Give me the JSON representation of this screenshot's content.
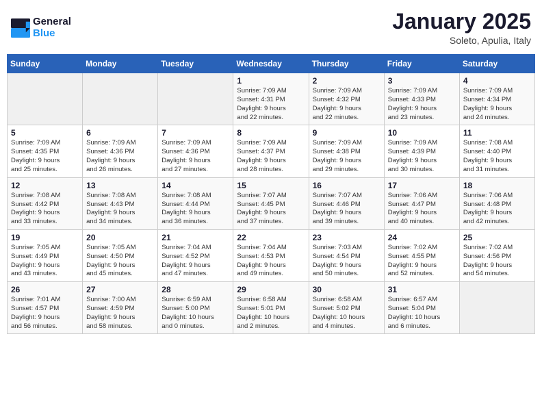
{
  "header": {
    "logo_line1": "General",
    "logo_line2": "Blue",
    "month": "January 2025",
    "location": "Soleto, Apulia, Italy"
  },
  "weekdays": [
    "Sunday",
    "Monday",
    "Tuesday",
    "Wednesday",
    "Thursday",
    "Friday",
    "Saturday"
  ],
  "weeks": [
    [
      {
        "day": "",
        "info": ""
      },
      {
        "day": "",
        "info": ""
      },
      {
        "day": "",
        "info": ""
      },
      {
        "day": "1",
        "info": "Sunrise: 7:09 AM\nSunset: 4:31 PM\nDaylight: 9 hours\nand 22 minutes."
      },
      {
        "day": "2",
        "info": "Sunrise: 7:09 AM\nSunset: 4:32 PM\nDaylight: 9 hours\nand 22 minutes."
      },
      {
        "day": "3",
        "info": "Sunrise: 7:09 AM\nSunset: 4:33 PM\nDaylight: 9 hours\nand 23 minutes."
      },
      {
        "day": "4",
        "info": "Sunrise: 7:09 AM\nSunset: 4:34 PM\nDaylight: 9 hours\nand 24 minutes."
      }
    ],
    [
      {
        "day": "5",
        "info": "Sunrise: 7:09 AM\nSunset: 4:35 PM\nDaylight: 9 hours\nand 25 minutes."
      },
      {
        "day": "6",
        "info": "Sunrise: 7:09 AM\nSunset: 4:36 PM\nDaylight: 9 hours\nand 26 minutes."
      },
      {
        "day": "7",
        "info": "Sunrise: 7:09 AM\nSunset: 4:36 PM\nDaylight: 9 hours\nand 27 minutes."
      },
      {
        "day": "8",
        "info": "Sunrise: 7:09 AM\nSunset: 4:37 PM\nDaylight: 9 hours\nand 28 minutes."
      },
      {
        "day": "9",
        "info": "Sunrise: 7:09 AM\nSunset: 4:38 PM\nDaylight: 9 hours\nand 29 minutes."
      },
      {
        "day": "10",
        "info": "Sunrise: 7:09 AM\nSunset: 4:39 PM\nDaylight: 9 hours\nand 30 minutes."
      },
      {
        "day": "11",
        "info": "Sunrise: 7:08 AM\nSunset: 4:40 PM\nDaylight: 9 hours\nand 31 minutes."
      }
    ],
    [
      {
        "day": "12",
        "info": "Sunrise: 7:08 AM\nSunset: 4:42 PM\nDaylight: 9 hours\nand 33 minutes."
      },
      {
        "day": "13",
        "info": "Sunrise: 7:08 AM\nSunset: 4:43 PM\nDaylight: 9 hours\nand 34 minutes."
      },
      {
        "day": "14",
        "info": "Sunrise: 7:08 AM\nSunset: 4:44 PM\nDaylight: 9 hours\nand 36 minutes."
      },
      {
        "day": "15",
        "info": "Sunrise: 7:07 AM\nSunset: 4:45 PM\nDaylight: 9 hours\nand 37 minutes."
      },
      {
        "day": "16",
        "info": "Sunrise: 7:07 AM\nSunset: 4:46 PM\nDaylight: 9 hours\nand 39 minutes."
      },
      {
        "day": "17",
        "info": "Sunrise: 7:06 AM\nSunset: 4:47 PM\nDaylight: 9 hours\nand 40 minutes."
      },
      {
        "day": "18",
        "info": "Sunrise: 7:06 AM\nSunset: 4:48 PM\nDaylight: 9 hours\nand 42 minutes."
      }
    ],
    [
      {
        "day": "19",
        "info": "Sunrise: 7:05 AM\nSunset: 4:49 PM\nDaylight: 9 hours\nand 43 minutes."
      },
      {
        "day": "20",
        "info": "Sunrise: 7:05 AM\nSunset: 4:50 PM\nDaylight: 9 hours\nand 45 minutes."
      },
      {
        "day": "21",
        "info": "Sunrise: 7:04 AM\nSunset: 4:52 PM\nDaylight: 9 hours\nand 47 minutes."
      },
      {
        "day": "22",
        "info": "Sunrise: 7:04 AM\nSunset: 4:53 PM\nDaylight: 9 hours\nand 49 minutes."
      },
      {
        "day": "23",
        "info": "Sunrise: 7:03 AM\nSunset: 4:54 PM\nDaylight: 9 hours\nand 50 minutes."
      },
      {
        "day": "24",
        "info": "Sunrise: 7:02 AM\nSunset: 4:55 PM\nDaylight: 9 hours\nand 52 minutes."
      },
      {
        "day": "25",
        "info": "Sunrise: 7:02 AM\nSunset: 4:56 PM\nDaylight: 9 hours\nand 54 minutes."
      }
    ],
    [
      {
        "day": "26",
        "info": "Sunrise: 7:01 AM\nSunset: 4:57 PM\nDaylight: 9 hours\nand 56 minutes."
      },
      {
        "day": "27",
        "info": "Sunrise: 7:00 AM\nSunset: 4:59 PM\nDaylight: 9 hours\nand 58 minutes."
      },
      {
        "day": "28",
        "info": "Sunrise: 6:59 AM\nSunset: 5:00 PM\nDaylight: 10 hours\nand 0 minutes."
      },
      {
        "day": "29",
        "info": "Sunrise: 6:58 AM\nSunset: 5:01 PM\nDaylight: 10 hours\nand 2 minutes."
      },
      {
        "day": "30",
        "info": "Sunrise: 6:58 AM\nSunset: 5:02 PM\nDaylight: 10 hours\nand 4 minutes."
      },
      {
        "day": "31",
        "info": "Sunrise: 6:57 AM\nSunset: 5:04 PM\nDaylight: 10 hours\nand 6 minutes."
      },
      {
        "day": "",
        "info": ""
      }
    ]
  ]
}
